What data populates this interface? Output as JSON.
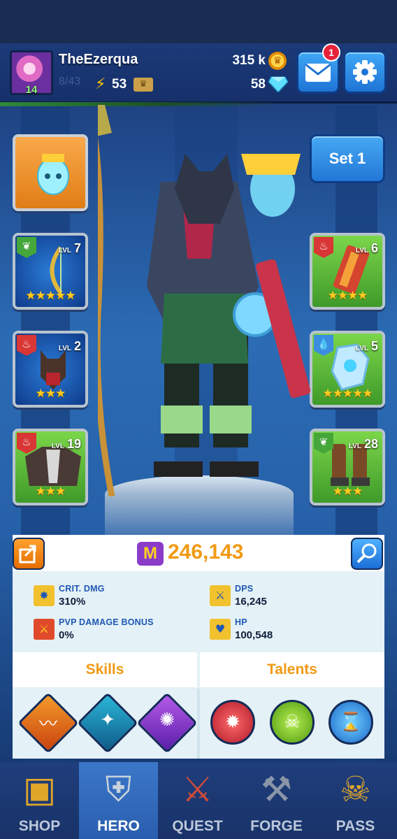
{
  "player": {
    "name": "TheEzerqua",
    "level": "14",
    "energy": "53",
    "faded_counter": "8/43"
  },
  "currency": {
    "gold": "315 k",
    "gems": "58"
  },
  "mail": {
    "unread_count": "1"
  },
  "loadout": {
    "set_label": "Set 1"
  },
  "equipment": {
    "left": [
      {
        "slot": "pet",
        "element": null,
        "level": null,
        "stars": null
      },
      {
        "slot": "weapon",
        "element": "nature",
        "level_label": "LVL",
        "level": "7",
        "stars": "★★★★★"
      },
      {
        "slot": "helmet",
        "element": "fire",
        "level_label": "LVL",
        "level": "2",
        "stars": "★★★"
      },
      {
        "slot": "armor",
        "element": "fire",
        "level_label": "LVL",
        "level": "19",
        "stars": "★★★"
      }
    ],
    "right": [
      {
        "slot": "offhand",
        "element": "fire",
        "level_label": "LVL",
        "level": "6",
        "stars": "★★★★"
      },
      {
        "slot": "gloves",
        "element": "water",
        "level_label": "LVL",
        "level": "5",
        "stars": "★★★★★"
      },
      {
        "slot": "boots",
        "element": "nature",
        "level_label": "LVL",
        "level": "28",
        "stars": "★★★"
      }
    ]
  },
  "power": {
    "icon_letter": "M",
    "value": "246,143"
  },
  "stats": [
    {
      "label": "CRIT. DMG",
      "value": "310%"
    },
    {
      "label": "DPS",
      "value": "16,245"
    },
    {
      "label": "PVP DAMAGE BONUS",
      "value": "0%"
    },
    {
      "label": "HP",
      "value": "100,548"
    }
  ],
  "tabs": {
    "skills": "Skills",
    "talents": "Talents"
  },
  "nav": {
    "shop": "SHOP",
    "hero": "HERO",
    "quest": "QUEST",
    "forge": "FORGE",
    "pass": "PASS"
  },
  "colors": {
    "accent_orange": "#f19a14",
    "stat_label_blue": "#1f58b5",
    "star_gold": "#ffcc1f",
    "button_blue": "#2177d6"
  }
}
